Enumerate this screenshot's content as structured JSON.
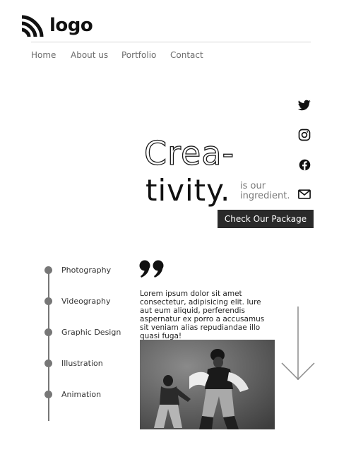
{
  "brand": {
    "logo_text": "logo"
  },
  "nav": {
    "items": [
      "Home",
      "About us",
      "Portfolio",
      "Contact"
    ]
  },
  "social": {
    "icons": [
      "twitter-icon",
      "instagram-icon",
      "facebook-icon",
      "mail-icon"
    ]
  },
  "hero": {
    "line1": "Crea-",
    "line2": "tivity.",
    "tagline_1": "is our",
    "tagline_2": "ingredient.",
    "cta_label": "Check Our Package"
  },
  "timeline": {
    "items": [
      "Photography",
      "Videography",
      "Graphic Design",
      "Illustration",
      "Animation"
    ]
  },
  "quote": {
    "text": "Lorem ipsum dolor sit amet consectetur, adipisicing elit. Iure aut eum aliquid, perferendis aspernatur ex porro a accusamus sit veniam alias repudiandae illo quasi fuga!"
  },
  "colors": {
    "accent_dark": "#2a2a2a",
    "text_muted": "#6c6c6c",
    "timeline_gray": "#777777"
  }
}
